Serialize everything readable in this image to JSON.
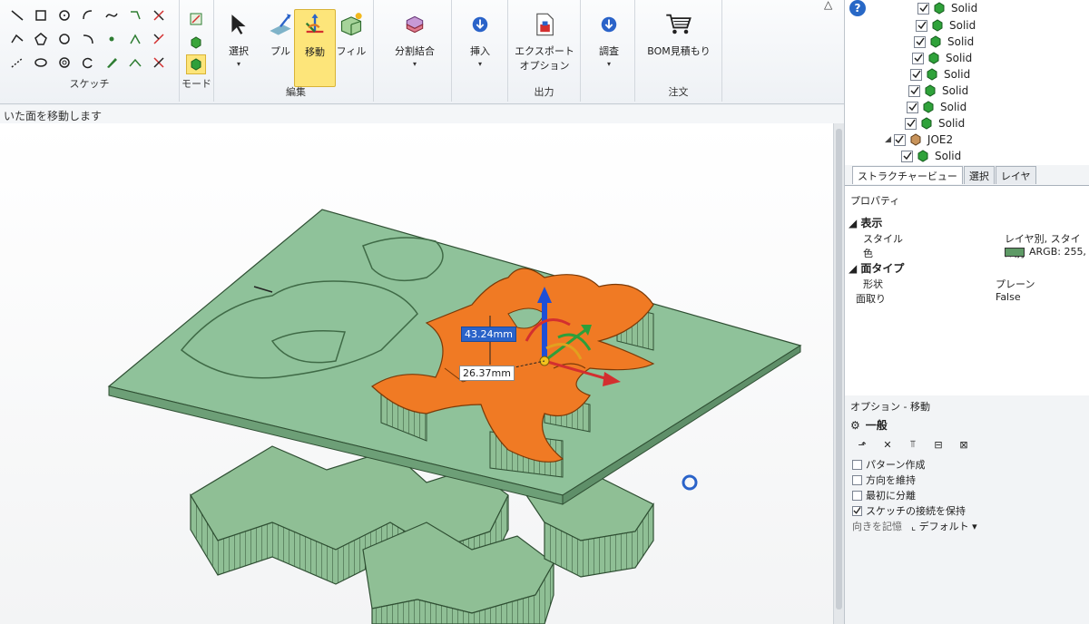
{
  "ribbon": {
    "sketch_group": "スケッチ",
    "mode_group": "モード",
    "edit_group": "編集",
    "output_group": "出力",
    "order_group": "注文",
    "select_label": "選択",
    "pull_label": "プル",
    "move_label": "移動",
    "fill_label": "フィル",
    "split_merge_label": "分割結合",
    "insert_label": "挿入",
    "export_label_1": "エクスポート",
    "export_label_2": "オプション",
    "inspect_label": "調査",
    "bom_label": "BOM見積もり"
  },
  "hint": "いた面を移動します",
  "viewport": {
    "dim_height": "43.24mm",
    "dim_offset": "26.37mm"
  },
  "tree": {
    "solid": "Solid",
    "component": "JOE2"
  },
  "tabs": [
    "ストラクチャービュー",
    "選択",
    "レイヤ"
  ],
  "properties": {
    "title": "プロパティ",
    "section_display": "表示",
    "style_key": "スタイル",
    "style_value": "レイヤ別, スタイル別",
    "color_key": "色",
    "color_value": "ARGB: 255,",
    "section_face": "面タイプ",
    "shape_key": "形状",
    "shape_value": "プレーン",
    "chamfer_key": "面取り",
    "chamfer_value": "False"
  },
  "options": {
    "title": "オプション - 移動",
    "section": "一般",
    "create_pattern": "パターン作成",
    "keep_direction": "方向を維持",
    "detach_first": "最初に分離",
    "keep_sketch": "スケッチの接続を保持",
    "orientation_label": "向きを記憶",
    "orientation_value": "デフォルト"
  },
  "colors": {
    "solid_green": "#8fbf95",
    "face_orange": "#f07a24",
    "select_blue": "#2a63c9"
  }
}
